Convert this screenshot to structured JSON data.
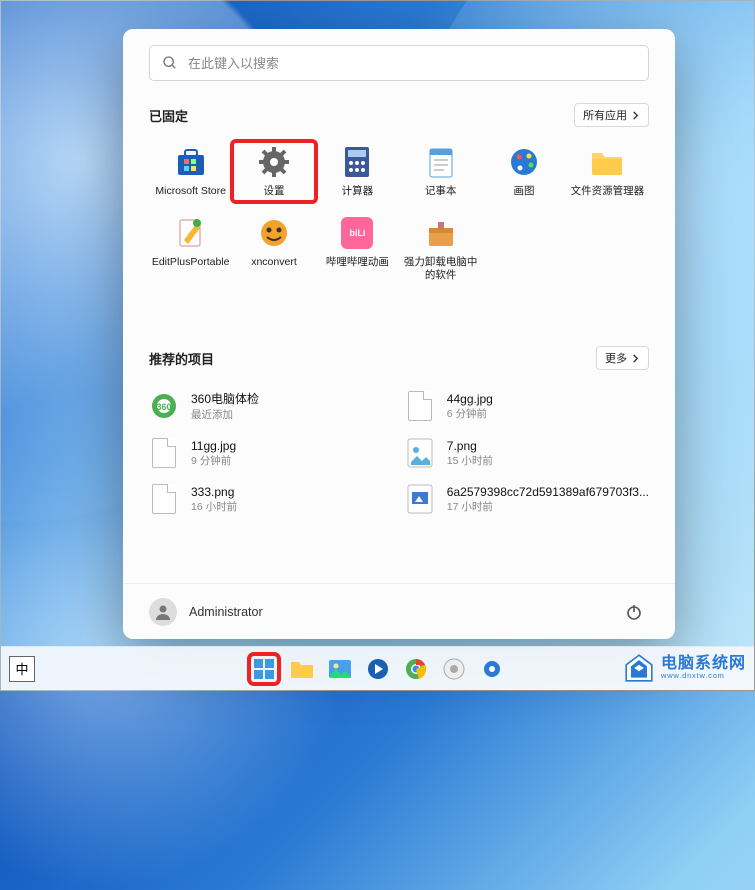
{
  "search": {
    "placeholder": "在此键入以搜索"
  },
  "pinned": {
    "title": "已固定",
    "all_apps": "所有应用",
    "items": [
      {
        "label": "Microsoft Store"
      },
      {
        "label": "设置"
      },
      {
        "label": "计算器"
      },
      {
        "label": "记事本"
      },
      {
        "label": "画图"
      },
      {
        "label": "文件资源管理器"
      },
      {
        "label": "EditPlusPortable"
      },
      {
        "label": "xnconvert"
      },
      {
        "label": "哔哩哔哩动画"
      },
      {
        "label": "强力卸载电脑中的软件"
      }
    ]
  },
  "recommended": {
    "title": "推荐的项目",
    "more": "更多",
    "items": [
      {
        "name": "360电脑体检",
        "meta": "最近添加",
        "kind": "app"
      },
      {
        "name": "44gg.jpg",
        "meta": "6 分钟前",
        "kind": "file"
      },
      {
        "name": "11gg.jpg",
        "meta": "9 分钟前",
        "kind": "file"
      },
      {
        "name": "7.png",
        "meta": "15 小时前",
        "kind": "img"
      },
      {
        "name": "333.png",
        "meta": "16 小时前",
        "kind": "file"
      },
      {
        "name": "6a2579398cc72d591389af679703f3...",
        "meta": "17 小时前",
        "kind": "img"
      }
    ]
  },
  "user": {
    "name": "Administrator"
  },
  "ime": "中",
  "brand": {
    "title": "电脑系统网",
    "sub": "www.dnxtw.com"
  }
}
